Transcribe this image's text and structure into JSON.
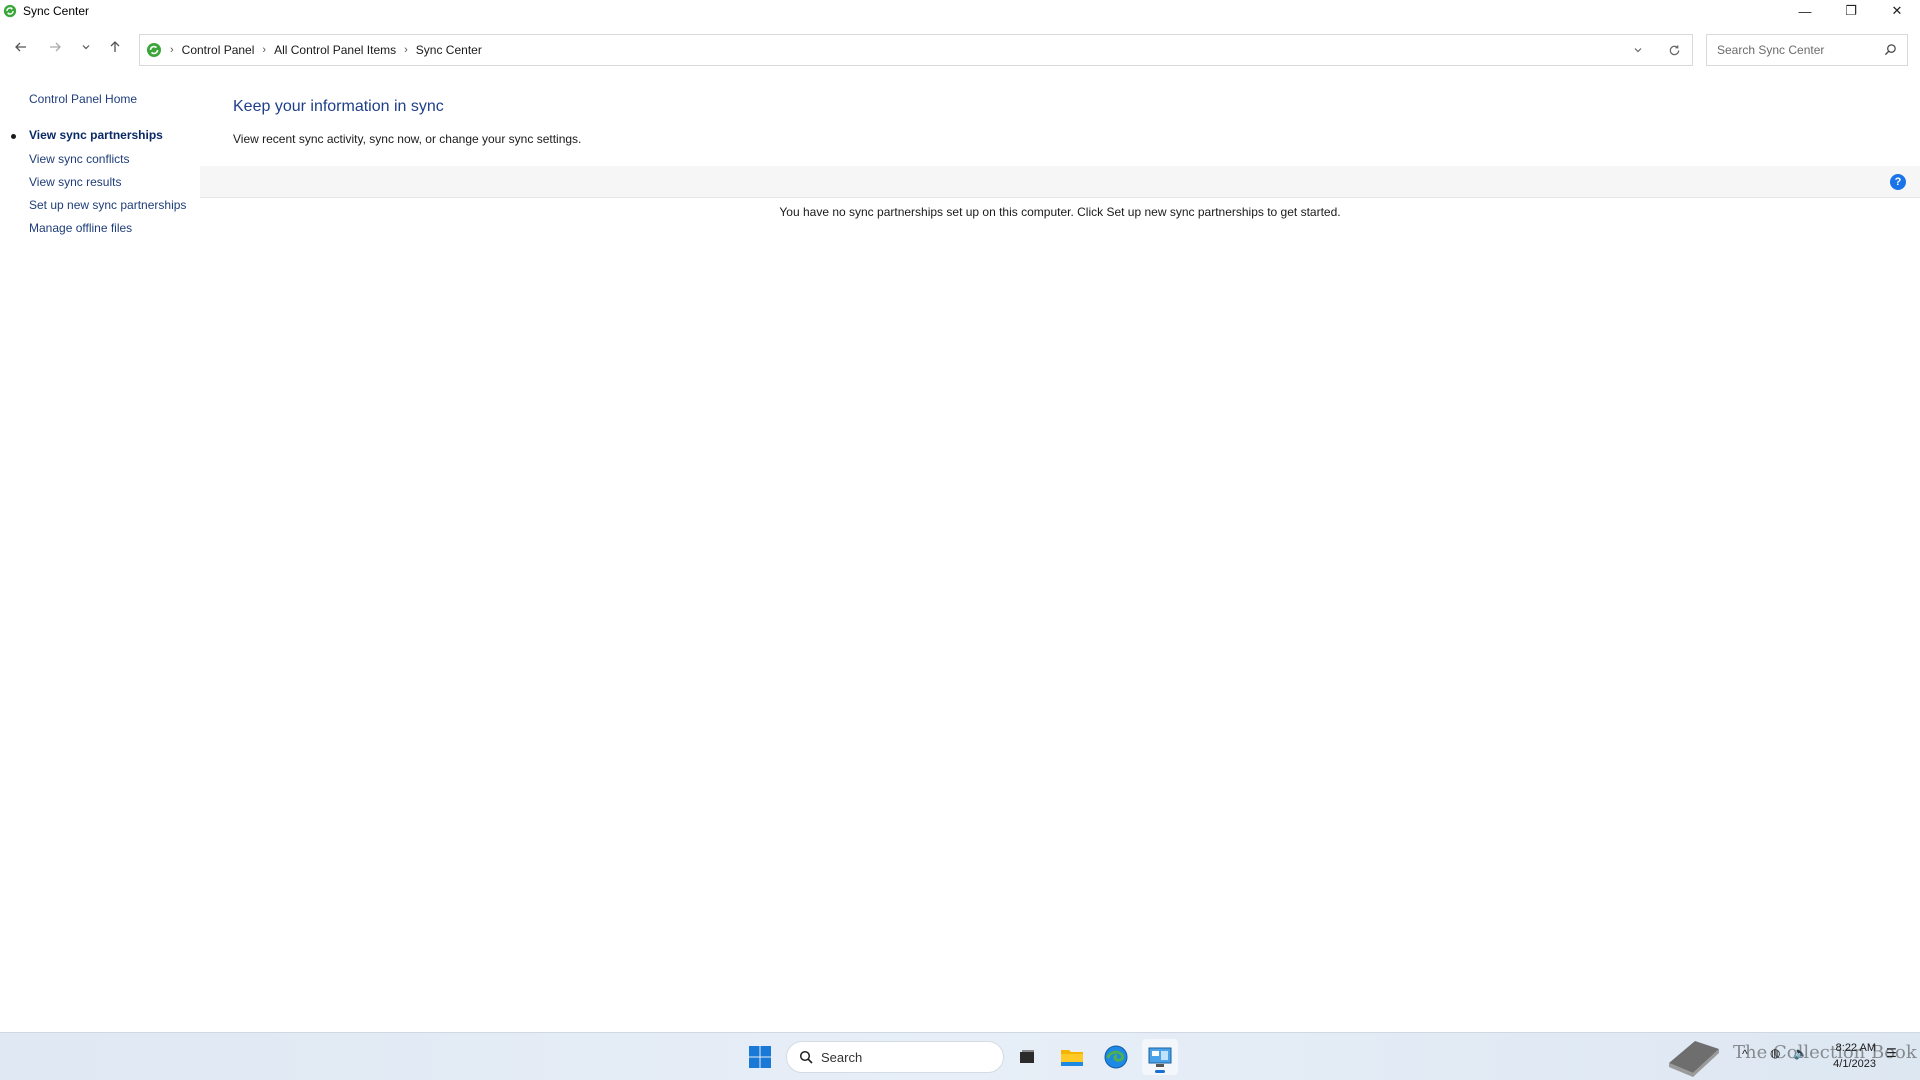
{
  "window": {
    "title": "Sync Center",
    "minimize_glyph": "—",
    "restore_glyph": "❐",
    "close_glyph": "✕"
  },
  "address": {
    "crumbs": [
      "Control Panel",
      "All Control Panel Items",
      "Sync Center"
    ],
    "search_placeholder": "Search Sync Center"
  },
  "leftnav": {
    "home": "Control Panel Home",
    "items": [
      {
        "label": "View sync partnerships",
        "current": true
      },
      {
        "label": "View sync conflicts"
      },
      {
        "label": "View sync results"
      },
      {
        "label": "Set up new sync partnerships"
      },
      {
        "label": "Manage offline files"
      }
    ]
  },
  "main": {
    "heading": "Keep your information in sync",
    "subtext": "View recent sync activity, sync now, or change your sync settings.",
    "empty_message": "You have no sync partnerships set up on this computer. Click Set up new sync partnerships to get started.",
    "help_glyph": "?"
  },
  "taskbar": {
    "search_label": "Search",
    "time": "8:22 AM",
    "date": "4/1/2023",
    "watermark": "The Collection Book"
  },
  "colors": {
    "link": "#1f3d7a",
    "heading": "#1e3f8a",
    "accent": "#1a73e8",
    "sync_green": "#3aa63a"
  }
}
